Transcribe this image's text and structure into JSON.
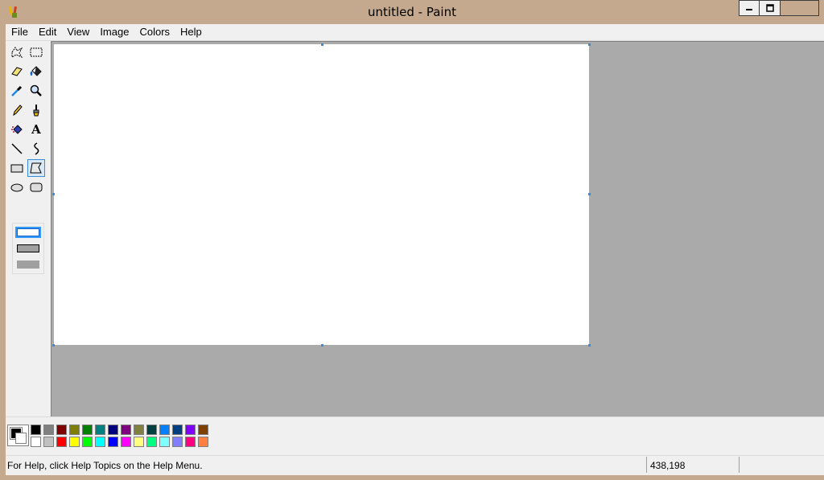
{
  "window": {
    "title": "untitled - Paint"
  },
  "menu": [
    "File",
    "Edit",
    "View",
    "Image",
    "Colors",
    "Help"
  ],
  "tools": [
    {
      "name": "free-form-select-icon"
    },
    {
      "name": "select-icon"
    },
    {
      "name": "eraser-icon"
    },
    {
      "name": "fill-bucket-icon"
    },
    {
      "name": "pick-color-icon"
    },
    {
      "name": "magnifier-icon"
    },
    {
      "name": "pencil-icon"
    },
    {
      "name": "brush-icon"
    },
    {
      "name": "airbrush-icon"
    },
    {
      "name": "text-icon"
    },
    {
      "name": "line-icon"
    },
    {
      "name": "curve-icon"
    },
    {
      "name": "rectangle-icon"
    },
    {
      "name": "polygon-icon"
    },
    {
      "name": "ellipse-icon"
    },
    {
      "name": "rounded-rectangle-icon"
    }
  ],
  "selected_tool": "polygon-icon",
  "text_tool_label": "A",
  "fill_options": [
    "outline",
    "outline-and-fill",
    "fill-only"
  ],
  "selected_fill_option": "outline",
  "colors": {
    "foreground": "#000000",
    "background": "#ffffff",
    "palette_top": [
      "#000000",
      "#808080",
      "#800000",
      "#808000",
      "#008000",
      "#008080",
      "#000080",
      "#800080",
      "#808040",
      "#004040",
      "#0080ff",
      "#004080",
      "#8000ff",
      "#804000"
    ],
    "palette_bottom": [
      "#ffffff",
      "#c0c0c0",
      "#ff0000",
      "#ffff00",
      "#00ff00",
      "#00ffff",
      "#0000ff",
      "#ff00ff",
      "#ffff80",
      "#00ff80",
      "#80ffff",
      "#8080ff",
      "#ff0080",
      "#ff8040"
    ]
  },
  "status": {
    "help_text": "For Help, click Help Topics on the Help Menu.",
    "coords": "438,198"
  }
}
